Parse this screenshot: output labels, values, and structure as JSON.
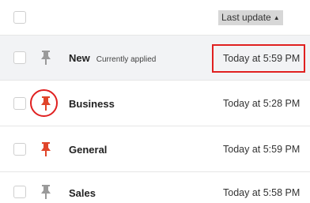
{
  "header": {
    "sort_column_label": "Last update",
    "sort_direction_icon": "sort-ascending-icon"
  },
  "rows": [
    {
      "name": "New",
      "status": "Currently applied",
      "last_update": "Today at 5:59 PM",
      "pinned": false,
      "pin_color": "#9a9a9a"
    },
    {
      "name": "Business",
      "status": "",
      "last_update": "Today at 5:28 PM",
      "pinned": true,
      "pin_color": "#e0452a"
    },
    {
      "name": "General",
      "status": "",
      "last_update": "Today at 5:59 PM",
      "pinned": true,
      "pin_color": "#e0452a"
    },
    {
      "name": "Sales",
      "status": "",
      "last_update": "Today at 5:58 PM",
      "pinned": false,
      "pin_color": "#9a9a9a"
    }
  ],
  "colors": {
    "annotation": "#e02020",
    "selected_row_bg": "#f2f3f5",
    "sort_header_bg": "#d7d7d7"
  }
}
